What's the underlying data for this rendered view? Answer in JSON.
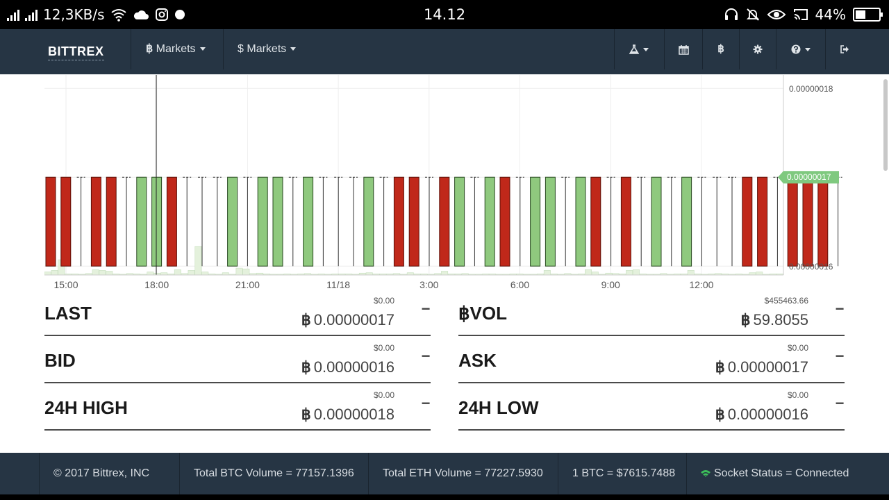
{
  "status_bar": {
    "speed": "12,3KB/s",
    "time": "14.12",
    "battery": "44%",
    "battery_level": 0.44,
    "icons": [
      "signal-icon",
      "signal-icon",
      "wifi-icon",
      "cloud-icon",
      "instagram-icon",
      "dot-icon",
      "headset-icon",
      "mute-icon",
      "eye-icon",
      "cast-icon",
      "battery-icon"
    ]
  },
  "navbar": {
    "brand": "BITTREX",
    "btc_markets": "Markets",
    "usd_markets": "Markets",
    "btc_symbol": "฿",
    "usd_symbol": "$",
    "icons": [
      "flask-icon",
      "calendar-icon",
      "bitcoin-icon",
      "gear-icon",
      "help-icon",
      "logout-icon"
    ]
  },
  "chart_data": {
    "type": "candlestick",
    "x_tick_labels": [
      "15:00",
      "18:00",
      "21:00",
      "11/18",
      "3:00",
      "6:00",
      "9:00",
      "12:00"
    ],
    "y_tick_labels": [
      "0.00000018",
      "0.00000017",
      "0.00000016"
    ],
    "y_ticks": [
      1.8e-07,
      1.7e-07,
      1.6e-07
    ],
    "last_price_label": "0.00000017",
    "ylim": [
      1.59e-07,
      1.815e-07
    ],
    "grid": true,
    "up_color": "#8fc97e",
    "down_color": "#c0281a",
    "candle_dirs": "ddfddfuudfffufuufufffufddfdufudfuufudfdfufufffddfdddffff",
    "volume": [
      8,
      12,
      40,
      3,
      3,
      2,
      4,
      14,
      12,
      10,
      3,
      2,
      4,
      3,
      2,
      8,
      5,
      6,
      3,
      14,
      4,
      12,
      75,
      8,
      3,
      2,
      6,
      2,
      18,
      16,
      4,
      5,
      3,
      2,
      2,
      3,
      2,
      3,
      4,
      2,
      3,
      2,
      3,
      3,
      3,
      2,
      5,
      6,
      3,
      3,
      3,
      4,
      2,
      6,
      3,
      3,
      2,
      4,
      10,
      3,
      3,
      4,
      2,
      2,
      3,
      3,
      2,
      2,
      3,
      3,
      2,
      2,
      3,
      12,
      3,
      2,
      4,
      2,
      3,
      14,
      8,
      2,
      5,
      4,
      3,
      12,
      14,
      3,
      2,
      2,
      4,
      2,
      3,
      3,
      12,
      3,
      2,
      3,
      4,
      3,
      2,
      3,
      2,
      6,
      8,
      2,
      3,
      3
    ]
  },
  "stats": {
    "last": {
      "label": "LAST",
      "usd": "$0.00",
      "value": "0.00000017"
    },
    "bvol": {
      "label": "฿VOL",
      "usd": "$455463.66",
      "value": "59.8055"
    },
    "bid": {
      "label": "BID",
      "usd": "$0.00",
      "value": "0.00000016"
    },
    "ask": {
      "label": "ASK",
      "usd": "$0.00",
      "value": "0.00000017"
    },
    "high": {
      "label": "24H HIGH",
      "usd": "$0.00",
      "value": "0.00000018"
    },
    "low": {
      "label": "24H LOW",
      "usd": "$0.00",
      "value": "0.00000016"
    },
    "currency_symbol": "฿",
    "collapse_label": "−"
  },
  "footer": {
    "copyright": "© 2017 Bittrex, INC",
    "btc_volume": "Total BTC Volume = 77157.1396",
    "eth_volume": "Total ETH Volume = 77227.5930",
    "btc_price": "1 BTC = $7615.7488",
    "socket_status": "Socket Status = Connected",
    "socket_color": "#3cbf5a"
  }
}
